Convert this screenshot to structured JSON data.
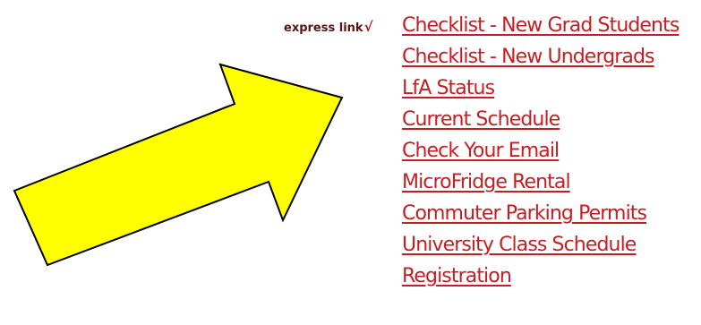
{
  "express_link": {
    "label": "express link",
    "check_glyph": "√",
    "label_color": "#5b1414"
  },
  "links": [
    {
      "label": "Checklist - New Grad Students"
    },
    {
      "label": "Checklist - New Undergrads"
    },
    {
      "label": "LfA Status"
    },
    {
      "label": "Current Schedule"
    },
    {
      "label": "Check Your Email"
    },
    {
      "label": "MicroFridge Rental"
    },
    {
      "label": "Commuter Parking Permits"
    },
    {
      "label": "University Class Schedule"
    },
    {
      "label": "Registration"
    }
  ],
  "colors": {
    "link": "#c41e23",
    "arrow_fill": "#ffff00",
    "arrow_stroke": "#000000",
    "background": "#ffffff"
  },
  "icons": {
    "arrow": "pointing-arrow-icon"
  }
}
